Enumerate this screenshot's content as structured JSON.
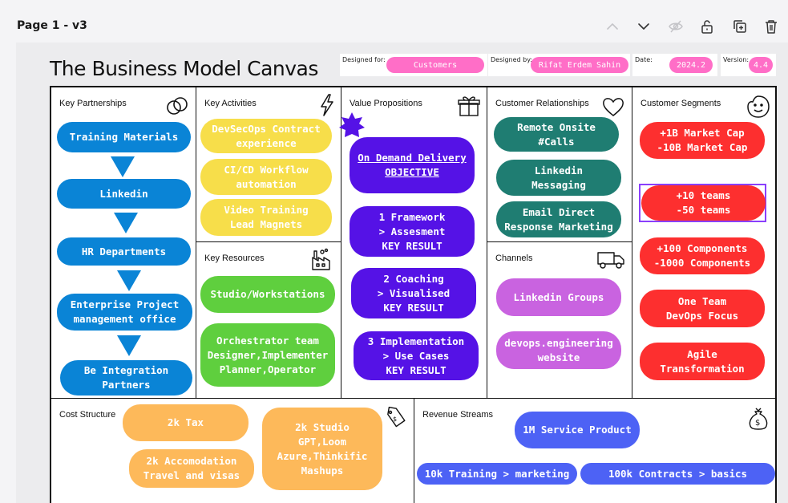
{
  "page_label": "Page 1 - v3",
  "toolbar": {
    "icons": [
      "chevron-up-icon",
      "chevron-down-icon",
      "eye-off-icon",
      "unlock-icon",
      "duplicate-icon",
      "trash-icon"
    ]
  },
  "canvas_title": "The Business Model Canvas",
  "meta": {
    "designed_for_label": "Designed for:",
    "designed_for_value": "Customers",
    "designed_by_label": "Designed by:",
    "designed_by_value": "Rifat Erdem Sahin",
    "date_label": "Date:",
    "date_value": "2024.2",
    "version_label": "Version:",
    "version_value": "4.4"
  },
  "sections": {
    "key_partnerships": {
      "title": "Key Partnerships",
      "items": [
        "Training Materials",
        "Linkedin",
        "HR Departments",
        "Enterprise Project\nmanagement office",
        "Be Integration\nPartners"
      ]
    },
    "key_activities": {
      "title": "Key Activities",
      "items": [
        "DevSecOps Contract\nexperience",
        "CI/CD Workflow\nautomation",
        "Video Training\nLead Magnets"
      ]
    },
    "key_resources": {
      "title": "Key Resources",
      "items": [
        "Studio/Workstations",
        "Orchestrator team\nDesigner,Implementer\nPlanner,Operator"
      ]
    },
    "value_propositions": {
      "title": "Value Propositions",
      "items": [
        "On Demand Delivery\nOBJECTIVE",
        "1 Framework\n> Assesment\nKEY RESULT",
        "2 Coaching\n> Visualised\nKEY RESULT",
        "3 Implementation\n> Use Cases\nKEY RESULT"
      ]
    },
    "customer_relationships": {
      "title": "Customer Relationships",
      "items": [
        "Remote Onsite\n#Calls",
        "Linkedin\nMessaging",
        "Email Direct\nResponse Marketing"
      ]
    },
    "channels": {
      "title": "Channels",
      "items": [
        "Linkedin Groups",
        "devops.engineering\nwebsite"
      ]
    },
    "customer_segments": {
      "title": "Customer Segments",
      "items": [
        "+1B  Market Cap\n-10B Market Cap",
        "+10 teams\n-50 teams",
        "+100 Components\n-1000 Components",
        "One Team\nDevOps Focus",
        "Agile\nTransformation"
      ]
    },
    "cost_structure": {
      "title": "Cost Structure",
      "items": [
        "2k Tax",
        "2k Studio\nGPT,Loom\nAzure,Thinkific\nMashups",
        "2k Accomodation\nTravel and visas"
      ]
    },
    "revenue_streams": {
      "title": "Revenue Streams",
      "items": [
        "1M Service Product",
        "10k Training > marketing",
        "100k Contracts > basics"
      ]
    }
  },
  "colors": {
    "blue": "#0a84d6",
    "yellow": "#f7de4a",
    "purple": "#5512e6",
    "teal": "#1f7d72",
    "red": "#fd2f2f",
    "green": "#5fcf3e",
    "lilac": "#c963e0",
    "orange": "#fdb95a",
    "periwinkle": "#4d62f5",
    "pink": "#ff6ec7",
    "selection": "#8a3ffc"
  }
}
